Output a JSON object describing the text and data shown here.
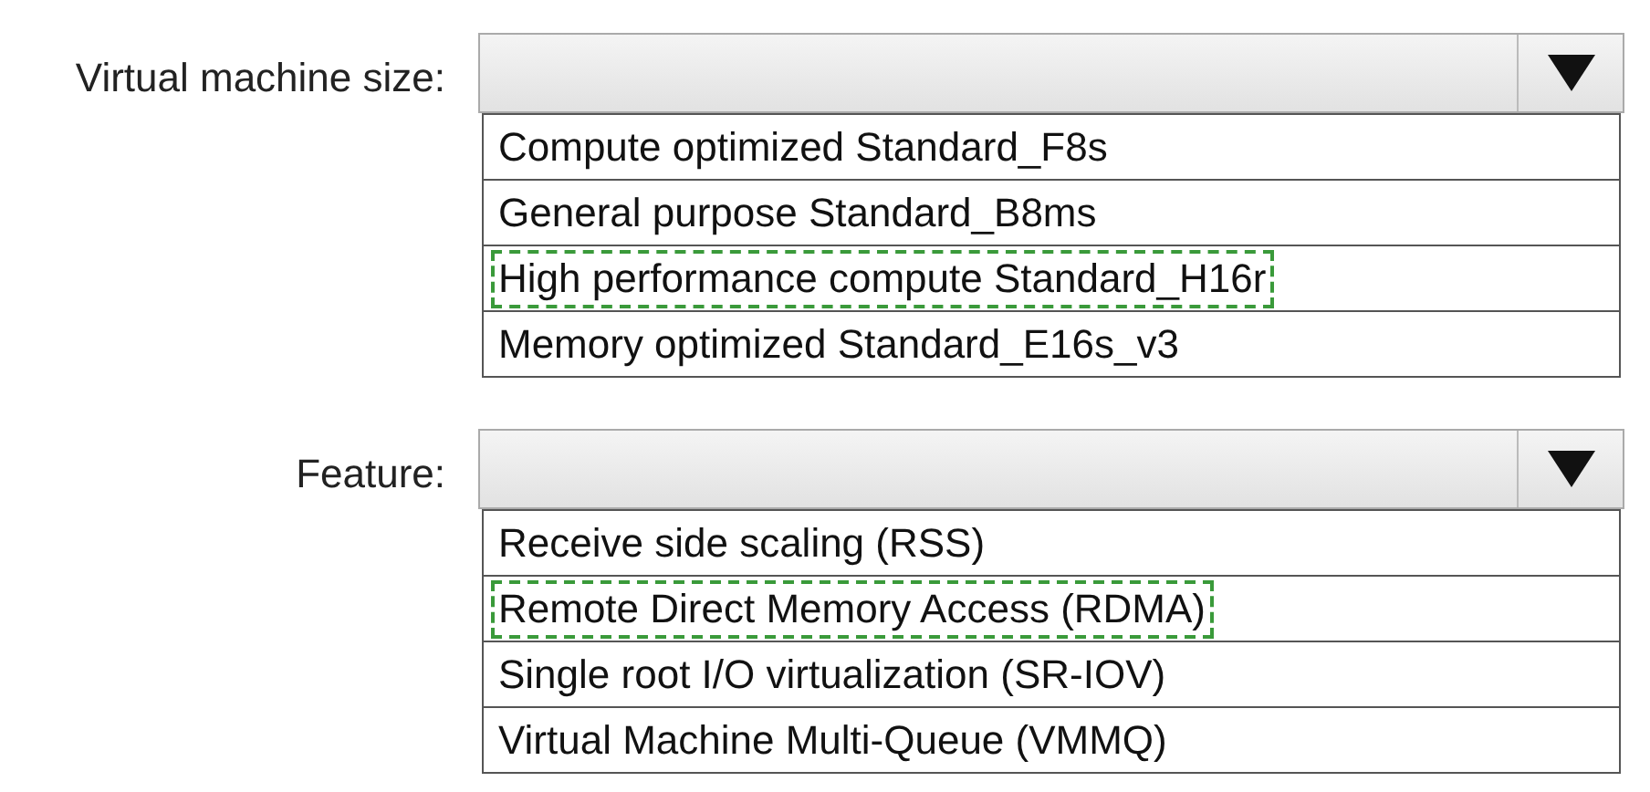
{
  "dropdowns": [
    {
      "label": "Virtual machine size:",
      "options": [
        {
          "text": "Compute optimized Standard_F8s",
          "selected": false
        },
        {
          "text": "General purpose Standard_B8ms",
          "selected": false
        },
        {
          "text": "High performance compute Standard_H16r",
          "selected": true
        },
        {
          "text": "Memory optimized Standard_E16s_v3",
          "selected": false
        }
      ]
    },
    {
      "label": "Feature:",
      "options": [
        {
          "text": "Receive side scaling (RSS)",
          "selected": false
        },
        {
          "text": "Remote Direct Memory Access (RDMA)",
          "selected": true
        },
        {
          "text": "Single root I/O virtualization (SR-IOV)",
          "selected": false
        },
        {
          "text": "Virtual Machine Multi-Queue (VMMQ)",
          "selected": false
        }
      ]
    }
  ]
}
